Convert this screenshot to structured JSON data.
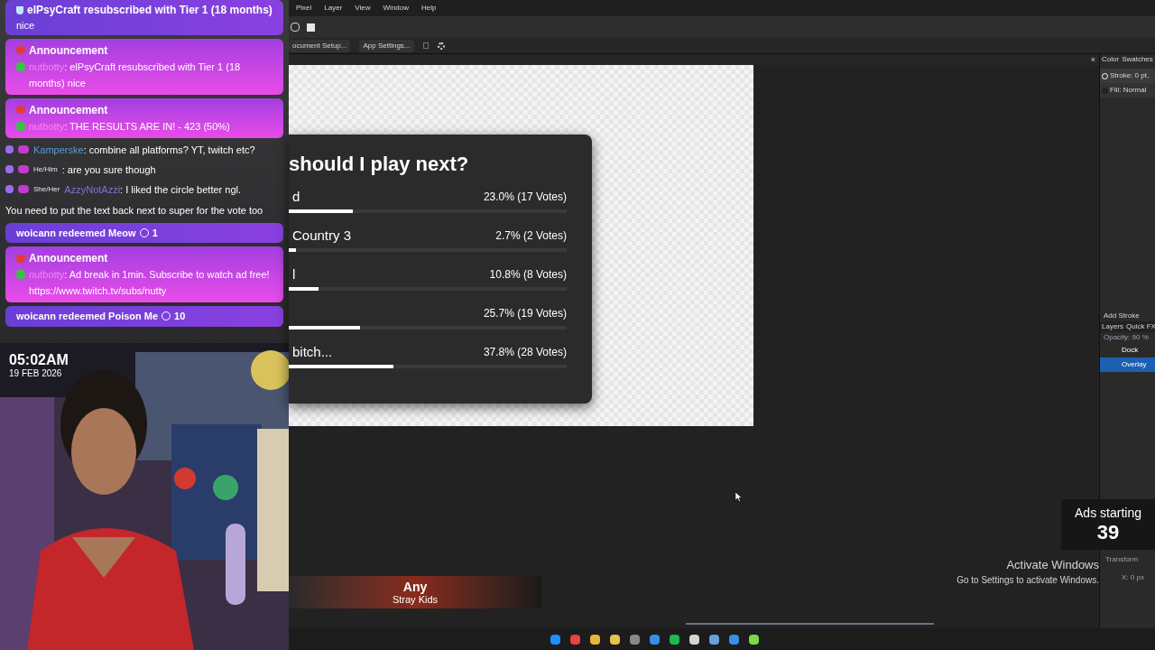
{
  "chat": [
    {
      "kind": "sub",
      "title": "elPsyCraft resubscribed with Tier 1 (18 months)",
      "text": "nice"
    },
    {
      "kind": "announcement",
      "title": "Announcement",
      "user": "nutbotty",
      "text": ": elPsyCraft resubscribed with Tier 1 (18 months) nice"
    },
    {
      "kind": "announcement",
      "title": "Announcement",
      "user": "nutbotty",
      "text": ": THE RESULTS ARE IN! - 423 (50%)"
    },
    {
      "kind": "message",
      "user": "Kamperske",
      "color": "#5b9bd5",
      "text": ": combine all platforms? YT, twitch etc?"
    },
    {
      "kind": "message",
      "pronoun": "He/Him",
      "text": ": are you sure though"
    },
    {
      "kind": "message",
      "pronoun": "She/Her",
      "user": "AzzyNotAzzi",
      "color": "#8a6fd1",
      "text": ": I liked the circle better ngl."
    },
    {
      "kind": "plain",
      "text": "You need to put the text back next to super for the vote too"
    },
    {
      "kind": "redeem",
      "title": "woicann redeemed Meow",
      "count": "1"
    },
    {
      "kind": "announcement",
      "title": "Announcement",
      "user": "nutbotty",
      "text": ": Ad break in 1min. Subscribe to watch ad free! https://www.twitch.tv/subs/nutty"
    },
    {
      "kind": "redeem",
      "title": "woicann redeemed Poison Me",
      "count": "10"
    }
  ],
  "webcam": {
    "time": "05:02AM",
    "date": "19 FEB 2026"
  },
  "menu": [
    "Pixel",
    "Layer",
    "View",
    "Window",
    "Help"
  ],
  "options_bar": [
    "ocument Setup...",
    "App Settings..."
  ],
  "poll": {
    "title": "should I play next?",
    "options": [
      {
        "label": "d",
        "result": "23.0% (17 Votes)",
        "level": 0.23
      },
      {
        "label": "Country 3",
        "result": "2.7% (2 Votes)",
        "level": 0.027
      },
      {
        "label": "l",
        "result": "10.8% (8 Votes)",
        "level": 0.108
      },
      {
        "result": "25.7% (19 Votes)",
        "level": 0.257
      },
      {
        "label": "bitch...",
        "result": "37.8% (28 Votes)",
        "level": 0.378
      }
    ]
  },
  "document_close": "×",
  "panel": {
    "tabs": [
      "Color",
      "Swatches"
    ],
    "stroke": "Stroke: 0 pt,",
    "fill": "Fill: Normal",
    "add": [
      "Add Stroke"
    ],
    "layer_tabs": [
      "Layers",
      "Quick FX"
    ],
    "opacity": "Opacity: 90 %",
    "layers": [
      {
        "name": "Dock",
        "selected": false
      },
      {
        "name": "Overlay",
        "selected": true
      }
    ],
    "transform": "Transform",
    "x": "X: 0 px"
  },
  "ads": {
    "label": "Ads starting",
    "count": "39"
  },
  "activate": {
    "title": "Activate Windows",
    "text": "Go to Settings to activate Windows."
  },
  "now_playing": {
    "title": "Any",
    "artist": "Stray Kids"
  }
}
